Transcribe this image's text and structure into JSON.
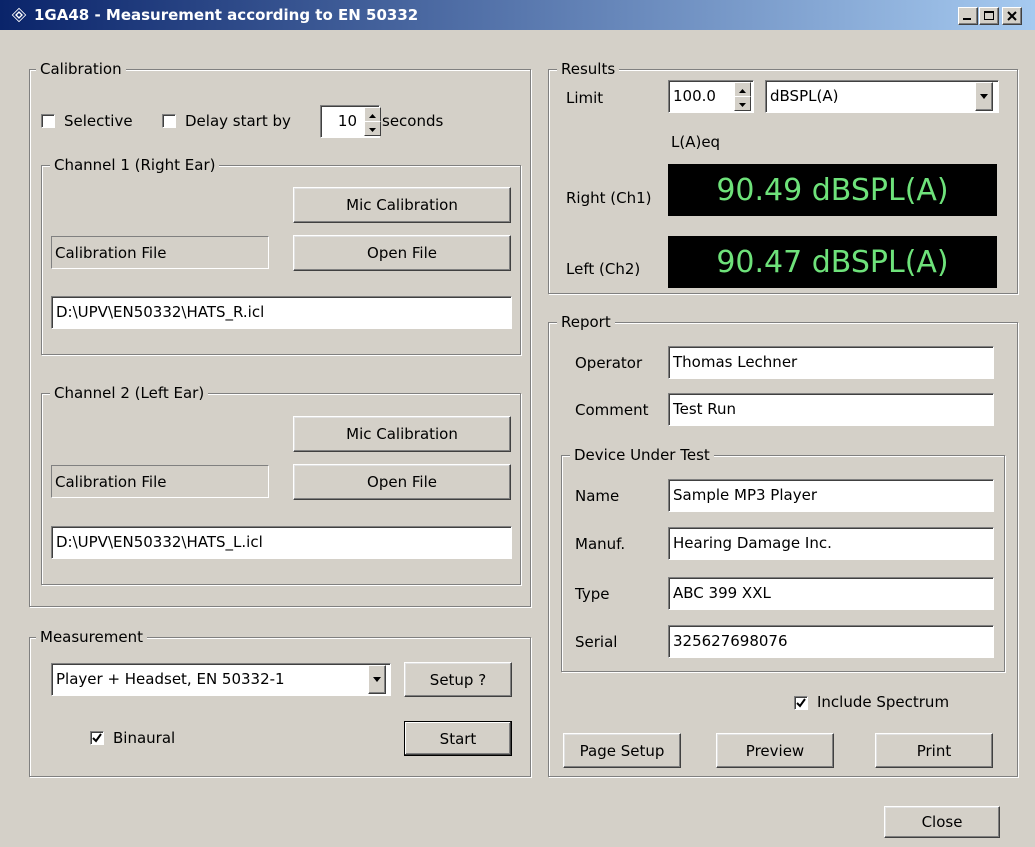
{
  "window": {
    "title": "1GA48 - Measurement according to EN 50332",
    "icon": "rs-diamond-icon",
    "title_colors": [
      "#0a246a",
      "#a6caf0"
    ]
  },
  "calibration": {
    "legend": "Calibration",
    "selective_label": "Selective",
    "selective_checked": false,
    "delay_label": "Delay start by",
    "delay_checked": false,
    "delay_value": "10",
    "seconds_label": "seconds",
    "ch1": {
      "legend": "Channel 1 (Right Ear)",
      "mic_button": "Mic Calibration",
      "file_label": "Calibration File",
      "open_button": "Open File",
      "path": "D:\\UPV\\EN50332\\HATS_R.icl"
    },
    "ch2": {
      "legend": "Channel 2 (Left Ear)",
      "mic_button": "Mic Calibration",
      "file_label": "Calibration File",
      "open_button": "Open File",
      "path": "D:\\UPV\\EN50332\\HATS_L.icl"
    }
  },
  "measurement": {
    "legend": "Measurement",
    "mode_selected": "Player + Headset, EN 50332-1",
    "setup_button": "Setup ?",
    "binaural_label": "Binaural",
    "binaural_checked": true,
    "start_button": "Start"
  },
  "results": {
    "legend": "Results",
    "limit_label": "Limit",
    "limit_value": "100.0",
    "unit_selected": "dBSPL(A)",
    "leq_label": "L(A)eq",
    "right_label": "Right (Ch1)",
    "right_value": "90.49 dBSPL(A)",
    "left_label": "Left (Ch2)",
    "left_value": "90.47 dBSPL(A)",
    "display_color": "#6ee27a"
  },
  "report": {
    "legend": "Report",
    "operator_label": "Operator",
    "operator_value": "Thomas Lechner",
    "comment_label": "Comment",
    "comment_value": "Test Run",
    "dut": {
      "legend": "Device Under Test",
      "name_label": "Name",
      "name_value": "Sample MP3 Player",
      "manuf_label": "Manuf.",
      "manuf_value": "Hearing Damage Inc.",
      "type_label": "Type",
      "type_value": "ABC 399 XXL",
      "serial_label": "Serial",
      "serial_value": "325627698076"
    },
    "include_spectrum_label": "Include Spectrum",
    "include_spectrum_checked": true,
    "page_setup_button": "Page Setup",
    "preview_button": "Preview",
    "print_button": "Print"
  },
  "close_button": "Close"
}
